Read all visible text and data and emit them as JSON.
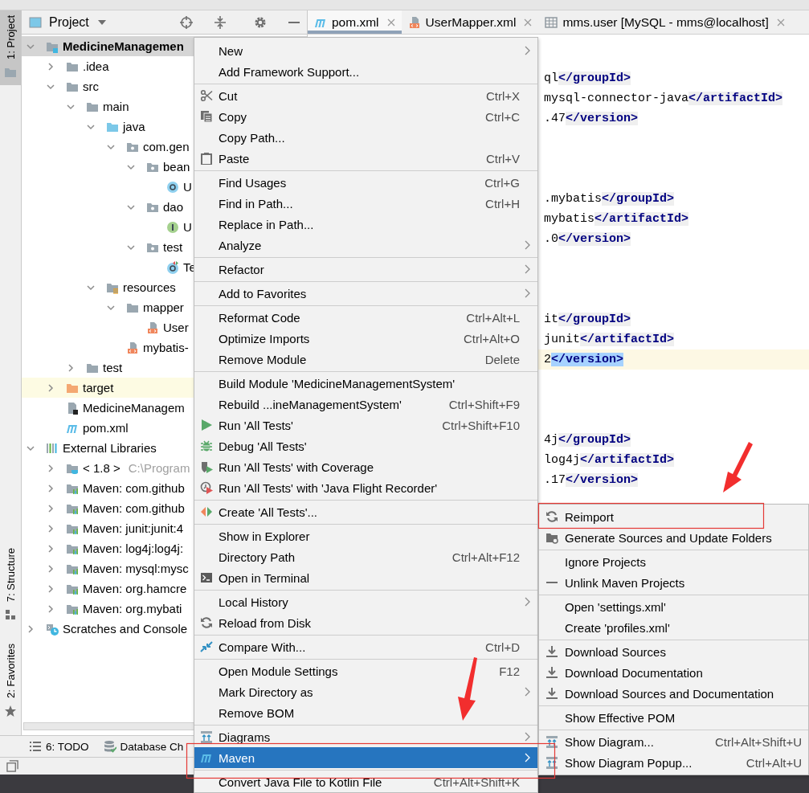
{
  "left_strip": {
    "top_tabs": [
      {
        "label": "1: Project",
        "selected": true,
        "kind": "folder"
      }
    ],
    "bottom_tabs": [
      {
        "label": "7: Structure",
        "selected": false,
        "kind": "structure"
      },
      {
        "label": "2: Favorites",
        "selected": false,
        "kind": "star"
      }
    ]
  },
  "project": {
    "title": "Project",
    "tree": [
      {
        "label": "MedicineManagemen",
        "kind": "project",
        "selected": true,
        "expanded": true,
        "children": [
          {
            "label": ".idea",
            "kind": "folder",
            "selected": false,
            "expanded": false
          },
          {
            "label": "src",
            "kind": "folder",
            "selected": false,
            "expanded": true,
            "children": [
              {
                "label": "main",
                "kind": "folder",
                "selected": false,
                "expanded": true,
                "children": [
                  {
                    "label": "java",
                    "kind": "source-folder",
                    "selected": false,
                    "expanded": true,
                    "children": [
                      {
                        "label": "com.gen",
                        "kind": "package",
                        "selected": false,
                        "expanded": true,
                        "children": [
                          {
                            "label": "bean",
                            "kind": "package",
                            "selected": false,
                            "expanded": true,
                            "children": [
                              {
                                "label": "U",
                                "kind": "class",
                                "selected": false
                              }
                            ]
                          },
                          {
                            "label": "dao",
                            "kind": "package",
                            "selected": false,
                            "expanded": true,
                            "children": [
                              {
                                "label": "U",
                                "kind": "interface",
                                "selected": false
                              }
                            ]
                          },
                          {
                            "label": "test",
                            "kind": "package",
                            "selected": false,
                            "expanded": true,
                            "children": [
                              {
                                "label": "Te",
                                "kind": "test-class",
                                "selected": false
                              }
                            ]
                          }
                        ]
                      }
                    ]
                  },
                  {
                    "label": "resources",
                    "kind": "resources",
                    "selected": false,
                    "expanded": true,
                    "children": [
                      {
                        "label": "mapper",
                        "kind": "folder",
                        "selected": false,
                        "expanded": true,
                        "children": [
                          {
                            "label": "User",
                            "kind": "xml",
                            "selected": false
                          }
                        ]
                      },
                      {
                        "label": "mybatis-",
                        "kind": "xml",
                        "selected": false
                      }
                    ]
                  }
                ]
              },
              {
                "label": "test",
                "kind": "folder",
                "selected": false,
                "expanded": false
              }
            ]
          },
          {
            "label": "target",
            "kind": "excluded-folder",
            "selected": false,
            "expanded": false
          },
          {
            "label": "MedicineManagem",
            "kind": "iml",
            "selected": false
          },
          {
            "label": "pom.xml",
            "kind": "maven",
            "selected": false
          }
        ]
      },
      {
        "label": "External Libraries",
        "kind": "libraries",
        "selected": false,
        "expanded": true,
        "children": [
          {
            "label": "< 1.8 >",
            "detail": "C:\\Program",
            "kind": "jdk",
            "selected": false,
            "expanded": false
          },
          {
            "label": "Maven: com.github",
            "kind": "library",
            "selected": false,
            "expanded": false
          },
          {
            "label": "Maven: com.github",
            "kind": "library",
            "selected": false,
            "expanded": false
          },
          {
            "label": "Maven: junit:junit:4",
            "kind": "library",
            "selected": false,
            "expanded": false
          },
          {
            "label": "Maven: log4j:log4j:",
            "kind": "library",
            "selected": false,
            "expanded": false
          },
          {
            "label": "Maven: mysql:mysc",
            "kind": "library",
            "selected": false,
            "expanded": false
          },
          {
            "label": "Maven: org.hamcre",
            "kind": "library",
            "selected": false,
            "expanded": false
          },
          {
            "label": "Maven: org.mybati",
            "kind": "library",
            "selected": false,
            "expanded": false
          }
        ]
      },
      {
        "label": "Scratches and Console",
        "kind": "scratches",
        "selected": false,
        "expanded": false
      }
    ]
  },
  "editor": {
    "tabs": [
      {
        "label": "pom.xml",
        "kind": "maven",
        "selected": true
      },
      {
        "label": "UserMapper.xml",
        "kind": "xml",
        "selected": false
      },
      {
        "label": "mms.user [MySQL - mms@localhost]",
        "kind": "table",
        "selected": false
      }
    ],
    "code_blocks": [
      [
        {
          "text": "ql",
          "tag": "</groupId>",
          "current": false,
          "selected": false
        },
        {
          "text": "mysql-connector-java",
          "tag": "</artifactId>",
          "current": false,
          "selected": false
        },
        {
          "text": ".47",
          "tag": "</version>",
          "current": false,
          "selected": false
        }
      ],
      [
        {
          "text": ".mybatis",
          "tag": "</groupId>",
          "current": false,
          "selected": false
        },
        {
          "text": "mybatis",
          "tag": "</artifactId>",
          "current": false,
          "selected": false
        },
        {
          "text": ".0",
          "tag": "</version>",
          "current": false,
          "selected": false
        }
      ],
      [
        {
          "text": "it",
          "tag": "</groupId>",
          "current": false,
          "selected": false
        },
        {
          "text": "junit",
          "tag": "</artifactId>",
          "current": false,
          "selected": false
        },
        {
          "text": "2",
          "tag": "</version>",
          "current": true,
          "selected": true
        }
      ],
      [
        {
          "text": "4j",
          "tag": "</groupId>",
          "current": false,
          "selected": false
        },
        {
          "text": "log4j",
          "tag": "</artifactId>",
          "current": false,
          "selected": false
        },
        {
          "text": ".17",
          "tag": "</version>",
          "current": false,
          "selected": false
        }
      ]
    ]
  },
  "tool_tabs": [
    {
      "label": "6: TODO",
      "kind": "list"
    },
    {
      "label": "Database Ch",
      "kind": "database"
    }
  ],
  "context_menu": {
    "groups": [
      [
        {
          "label": "New",
          "submenu": true,
          "selected": false
        },
        {
          "label": "Add Framework Support...",
          "submenu": false,
          "selected": false
        }
      ],
      [
        {
          "label": "Cut",
          "shortcut": "Ctrl+X",
          "kind": "scissors",
          "submenu": false,
          "selected": false
        },
        {
          "label": "Copy",
          "shortcut": "Ctrl+C",
          "kind": "copy",
          "submenu": false,
          "selected": false
        },
        {
          "label": "Copy Path...",
          "submenu": false,
          "selected": false
        },
        {
          "label": "Paste",
          "shortcut": "Ctrl+V",
          "kind": "paste",
          "submenu": false,
          "selected": false
        }
      ],
      [
        {
          "label": "Find Usages",
          "shortcut": "Ctrl+G",
          "submenu": false,
          "selected": false
        },
        {
          "label": "Find in Path...",
          "shortcut": "Ctrl+H",
          "submenu": false,
          "selected": false
        },
        {
          "label": "Replace in Path...",
          "submenu": false,
          "selected": false
        },
        {
          "label": "Analyze",
          "submenu": true,
          "selected": false
        }
      ],
      [
        {
          "label": "Refactor",
          "submenu": true,
          "selected": false
        }
      ],
      [
        {
          "label": "Add to Favorites",
          "submenu": true,
          "selected": false
        }
      ],
      [
        {
          "label": "Reformat Code",
          "shortcut": "Ctrl+Alt+L",
          "submenu": false,
          "selected": false
        },
        {
          "label": "Optimize Imports",
          "shortcut": "Ctrl+Alt+O",
          "submenu": false,
          "selected": false
        },
        {
          "label": "Remove Module",
          "shortcut": "Delete",
          "submenu": false,
          "selected": false
        }
      ],
      [
        {
          "label": "Build Module 'MedicineManagementSystem'",
          "submenu": false,
          "selected": false
        },
        {
          "label": "Rebuild ...ineManagementSystem'",
          "shortcut": "Ctrl+Shift+F9",
          "submenu": false,
          "selected": false
        },
        {
          "label": "Run 'All Tests'",
          "shortcut": "Ctrl+Shift+F10",
          "kind": "run",
          "submenu": false,
          "selected": false
        },
        {
          "label": "Debug 'All Tests'",
          "kind": "debug",
          "submenu": false,
          "selected": false
        },
        {
          "label": "Run 'All Tests' with Coverage",
          "kind": "coverage",
          "submenu": false,
          "selected": false
        },
        {
          "label": "Run 'All Tests' with 'Java Flight Recorder'",
          "kind": "profiler",
          "submenu": false,
          "selected": false
        }
      ],
      [
        {
          "label": "Create 'All Tests'...",
          "kind": "create-test",
          "submenu": false,
          "selected": false
        }
      ],
      [
        {
          "label": "Show in Explorer",
          "submenu": false,
          "selected": false
        },
        {
          "label": "Directory Path",
          "shortcut": "Ctrl+Alt+F12",
          "submenu": false,
          "selected": false
        },
        {
          "label": "Open in Terminal",
          "kind": "terminal",
          "submenu": false,
          "selected": false
        }
      ],
      [
        {
          "label": "Local History",
          "submenu": true,
          "selected": false
        },
        {
          "label": "Reload from Disk",
          "kind": "reload",
          "submenu": false,
          "selected": false
        }
      ],
      [
        {
          "label": "Compare With...",
          "shortcut": "Ctrl+D",
          "kind": "compare",
          "submenu": false,
          "selected": false
        }
      ],
      [
        {
          "label": "Open Module Settings",
          "shortcut": "F12",
          "submenu": false,
          "selected": false
        },
        {
          "label": "Mark Directory as",
          "submenu": true,
          "selected": false
        },
        {
          "label": "Remove BOM",
          "submenu": false,
          "selected": false
        }
      ],
      [
        {
          "label": "Diagrams",
          "kind": "diagram",
          "submenu": true,
          "selected": false
        },
        {
          "label": "Maven",
          "kind": "maven",
          "submenu": true,
          "selected": true
        }
      ],
      [
        {
          "label": "Convert Java File to Kotlin File",
          "shortcut": "Ctrl+Alt+Shift+K",
          "submenu": false,
          "selected": false
        }
      ]
    ]
  },
  "maven_submenu": {
    "groups": [
      [
        {
          "label": "Reimport",
          "kind": "reload",
          "selected": false
        },
        {
          "label": "Generate Sources and Update Folders",
          "kind": "folder-gear",
          "selected": false
        }
      ],
      [
        {
          "label": "Ignore Projects",
          "selected": false
        },
        {
          "label": "Unlink Maven Projects",
          "kind": "minus",
          "selected": false
        }
      ],
      [
        {
          "label": "Open 'settings.xml'",
          "selected": false
        },
        {
          "label": "Create 'profiles.xml'",
          "selected": false
        }
      ],
      [
        {
          "label": "Download Sources",
          "kind": "download",
          "selected": false
        },
        {
          "label": "Download Documentation",
          "kind": "download",
          "selected": false
        },
        {
          "label": "Download Sources and Documentation",
          "kind": "download",
          "selected": false
        }
      ],
      [
        {
          "label": "Show Effective POM",
          "selected": false
        }
      ],
      [
        {
          "label": "Show Diagram...",
          "shortcut": "Ctrl+Alt+Shift+U",
          "kind": "diagram",
          "selected": false
        },
        {
          "label": "Show Diagram Popup...",
          "shortcut": "Ctrl+Alt+U",
          "kind": "diagram",
          "selected": false
        }
      ]
    ]
  }
}
